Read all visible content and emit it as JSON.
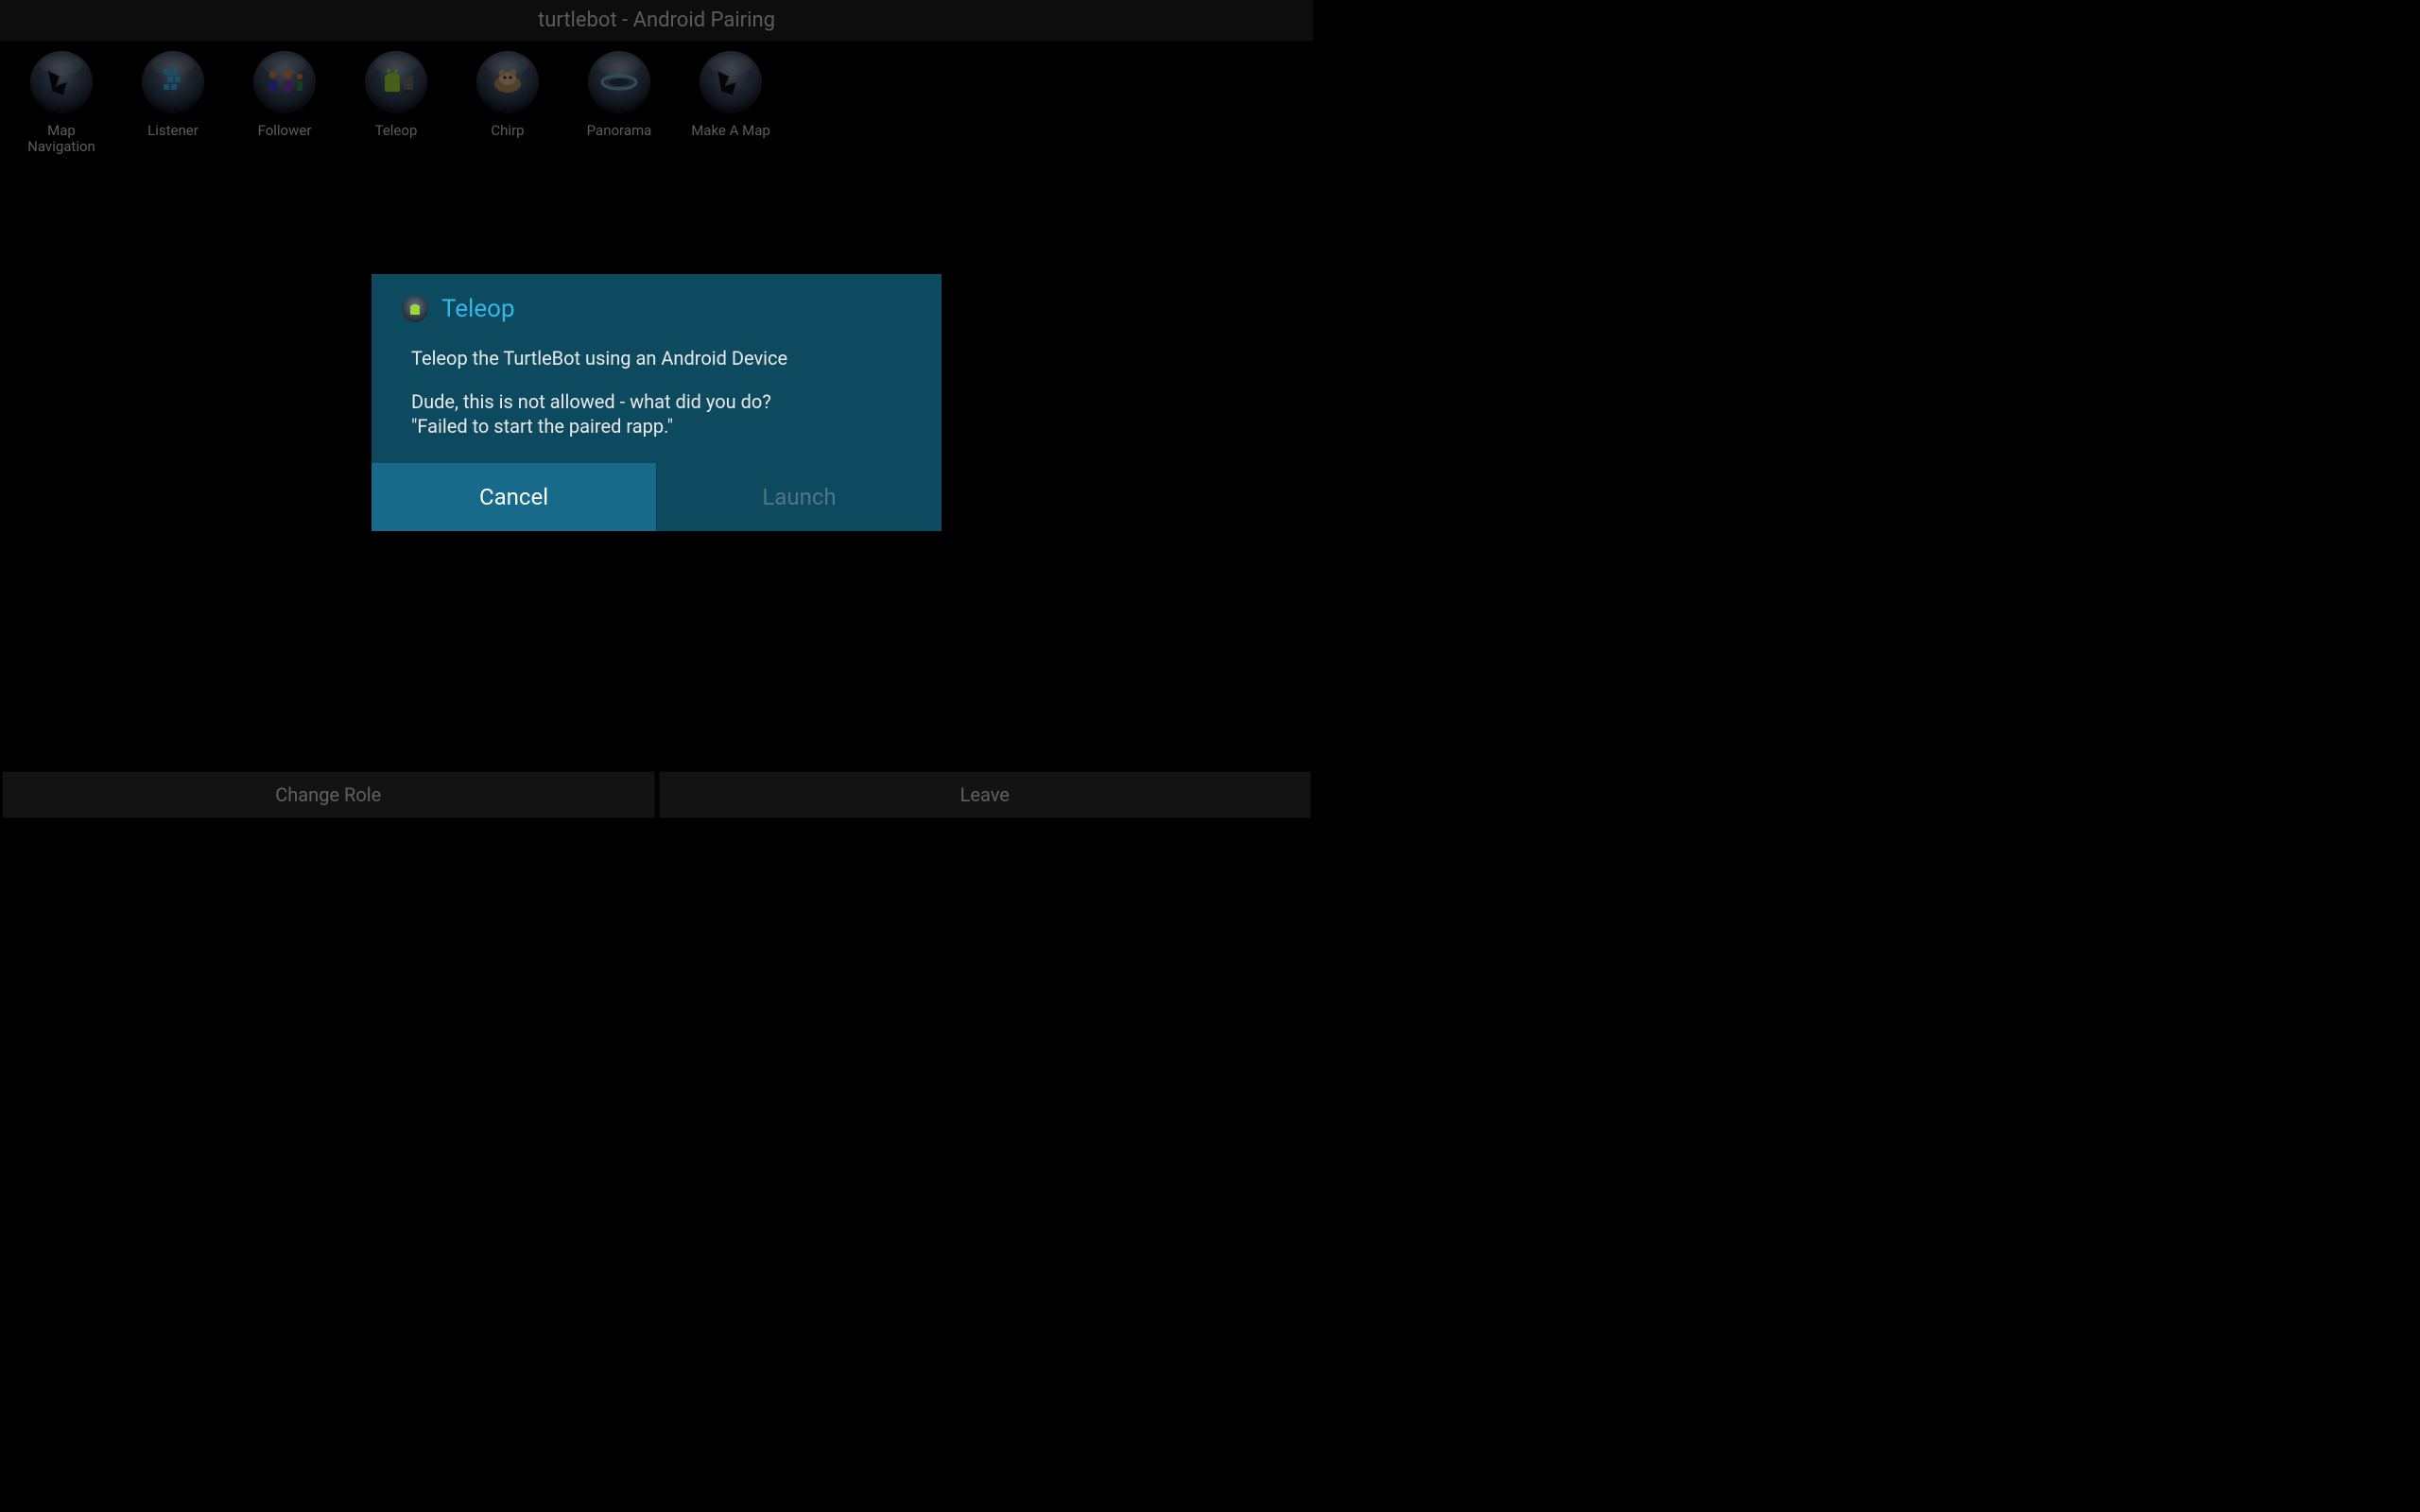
{
  "header": {
    "title": "turtlebot - Android Pairing"
  },
  "apps": [
    {
      "label": "Map Navigation",
      "icon": "map-nav-icon"
    },
    {
      "label": "Listener",
      "icon": "listener-icon"
    },
    {
      "label": "Follower",
      "icon": "follower-icon"
    },
    {
      "label": "Teleop",
      "icon": "teleop-icon"
    },
    {
      "label": "Chirp",
      "icon": "chirp-icon"
    },
    {
      "label": "Panorama",
      "icon": "panorama-icon"
    },
    {
      "label": "Make A Map",
      "icon": "make-map-icon"
    }
  ],
  "dialog": {
    "title": "Teleop",
    "body_line1": "Teleop the TurtleBot using an Android Device",
    "body_line2": "Dude, this is not allowed - what did you do?",
    "body_line3": "\"Failed to start the paired rapp.\"",
    "cancel_label": "Cancel",
    "launch_label": "Launch"
  },
  "footer": {
    "change_role_label": "Change Role",
    "leave_label": "Leave"
  }
}
